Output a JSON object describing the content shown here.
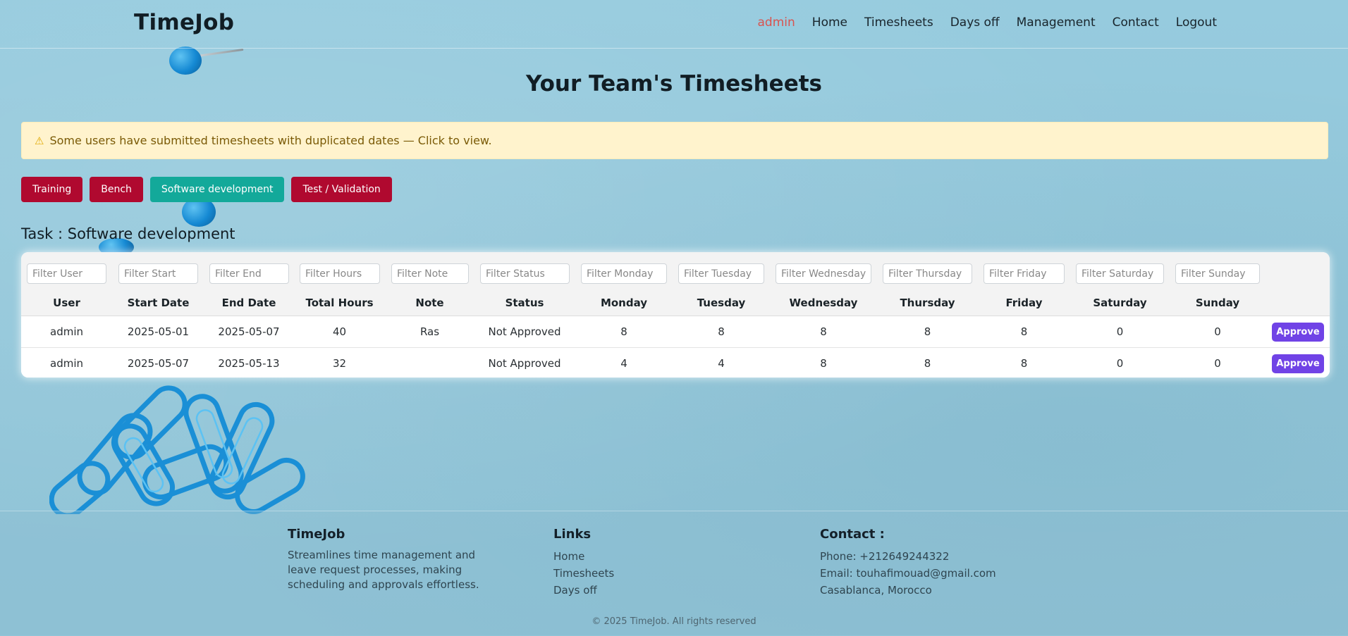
{
  "brand": "TimeJob",
  "nav": {
    "user": "admin",
    "items": [
      "Home",
      "Timesheets",
      "Days off",
      "Management",
      "Contact",
      "Logout"
    ]
  },
  "page_title": "Your Team's Timesheets",
  "alert": {
    "icon": "warning-icon",
    "text": "Some users have submitted timesheets with duplicated dates — Click to view."
  },
  "tasks": {
    "buttons": [
      "Training",
      "Bench",
      "Software development",
      "Test / Validation"
    ],
    "active": "Software development"
  },
  "task_title": "Task : Software development",
  "table": {
    "filters": [
      "Filter User",
      "Filter Start",
      "Filter End",
      "Filter Hours",
      "Filter Note",
      "Filter Status",
      "Filter Monday",
      "Filter Tuesday",
      "Filter Wednesday",
      "Filter Thursday",
      "Filter Friday",
      "Filter Saturday",
      "Filter Sunday"
    ],
    "headers": [
      "User",
      "Start Date",
      "End Date",
      "Total Hours",
      "Note",
      "Status",
      "Monday",
      "Tuesday",
      "Wednesday",
      "Thursday",
      "Friday",
      "Saturday",
      "Sunday"
    ],
    "rows": [
      [
        "admin",
        "2025-05-01",
        "2025-05-07",
        "40",
        "Ras",
        "Not Approved",
        "8",
        "8",
        "8",
        "8",
        "8",
        "0",
        "0"
      ],
      [
        "admin",
        "2025-05-07",
        "2025-05-13",
        "32",
        "",
        "Not Approved",
        "4",
        "4",
        "8",
        "8",
        "8",
        "0",
        "0"
      ]
    ],
    "approve_label": "Approve"
  },
  "footer": {
    "about_title": "TimeJob",
    "about_text": "Streamlines time management and leave request processes, making scheduling and approvals effortless.",
    "links_title": "Links",
    "links": [
      "Home",
      "Timesheets",
      "Days off"
    ],
    "contact_title": "Contact :",
    "contact": [
      "Phone: +212649244322",
      "Email: touhafimouad@gmail.com",
      "Casablanca, Morocco"
    ],
    "copyright": "© 2025 TimeJob. All rights reserved"
  },
  "colors": {
    "background": "#94c9dc",
    "active_nav": "#d9534f",
    "task_red": "#b0092f",
    "task_teal": "#13a99a",
    "approve": "#7043e6",
    "alert_bg": "#fff3cd"
  }
}
